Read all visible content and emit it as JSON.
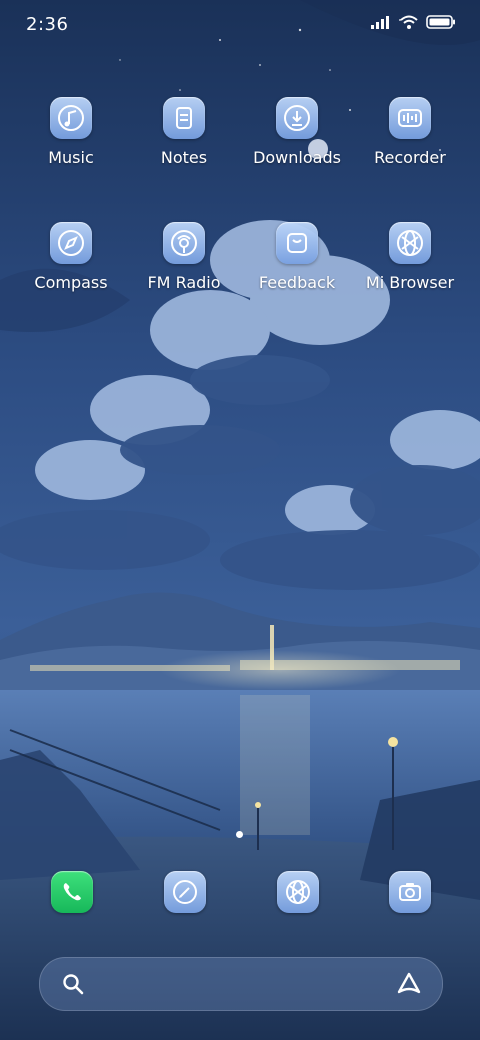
{
  "status_bar": {
    "time": "2:36",
    "icons": [
      "signal-icon",
      "wifi-icon",
      "battery-icon"
    ]
  },
  "apps": [
    {
      "label": "Music",
      "icon": "music-icon"
    },
    {
      "label": "Notes",
      "icon": "notes-icon"
    },
    {
      "label": "Downloads",
      "icon": "downloads-icon"
    },
    {
      "label": "Recorder",
      "icon": "recorder-icon"
    },
    {
      "label": "Compass",
      "icon": "compass-icon"
    },
    {
      "label": "FM Radio",
      "icon": "fm-radio-icon"
    },
    {
      "label": "Feedback",
      "icon": "feedback-icon"
    },
    {
      "label": "Mi Browser",
      "icon": "browser-icon"
    }
  ],
  "dock": [
    {
      "icon": "phone-icon"
    },
    {
      "icon": "messages-icon"
    },
    {
      "icon": "browser-icon"
    },
    {
      "icon": "camera-icon"
    }
  ],
  "search": {
    "icons": [
      "search-icon",
      "assistant-icon"
    ]
  },
  "page_indicator": {
    "pages": 1,
    "current": 1
  },
  "colors": {
    "sky_top": "#1d3560",
    "sky_mid": "#2e4f86",
    "water": "#4a6fa6",
    "icon_tint": "#9fbde8",
    "phone_green": "#22c466"
  }
}
